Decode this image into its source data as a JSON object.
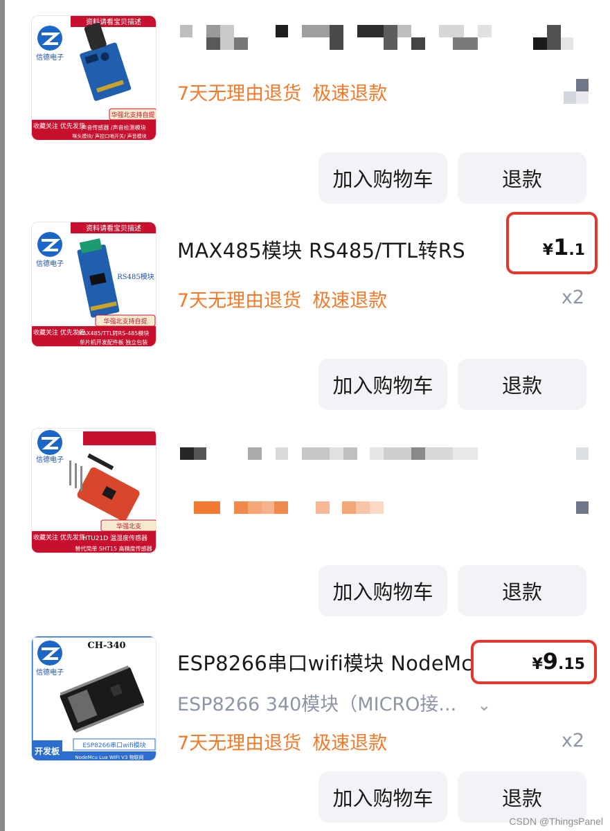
{
  "items": [
    {
      "thumb_top": "资料请看宝贝描述",
      "thumb_brand": "信德电子",
      "thumb_banner": "华强北支持自提",
      "thumb_bottom1": "声音传感器 /声音检测模块",
      "thumb_bottom2": "咪头模块/ 声控口哨开关/ 声音模块",
      "thumb_side": "收藏关注 优先发货",
      "title": "",
      "tags": [
        "7天无理由退货",
        "极速退款"
      ],
      "price": null,
      "qty": "",
      "buttons": {
        "cart": "加入购物车",
        "refund": "退款"
      }
    },
    {
      "thumb_top": "资料请看宝贝描述",
      "thumb_brand": "信德电子",
      "thumb_banner": "华强北支持自提",
      "thumb_label": "RS485模块",
      "thumb_bottom1": "MAX485/TTL转RS-485模块",
      "thumb_bottom2": "单片机开发配件板  独立包装",
      "thumb_side": "收藏关注 优先发货",
      "title": "MAX485模块 RS485/TTL转RS",
      "tags": [
        "7天无理由退货",
        "极速退款"
      ],
      "price": {
        "currency": "¥",
        "int": "1",
        "dec": ".1"
      },
      "qty": "x2",
      "buttons": {
        "cart": "加入购物车",
        "refund": "退款"
      }
    },
    {
      "thumb_brand": "信德电子",
      "thumb_banner": "华强北支",
      "thumb_bottom1": "HTU21D 温湿度传感器",
      "thumb_bottom2": "替代简单 SHT15 高精度传感器",
      "thumb_side": "收藏关注 优先发货",
      "title": "",
      "tags": [],
      "price": null,
      "qty": "",
      "buttons": {
        "cart": "加入购物车",
        "refund": "退款"
      }
    },
    {
      "thumb_top": "CH-340",
      "thumb_brand": "信德电子",
      "thumb_banner": "ESP8266串口wifi模块",
      "thumb_bottom2": "NodeMcu Lua WIFI V3 物联网",
      "thumb_side": "开发板",
      "title": "ESP8266串口wifi模块 NodeMc",
      "sku": "ESP8266 340模块（MICRO接...",
      "tags": [
        "7天无理由退货",
        "极速退款"
      ],
      "price": {
        "currency": "¥",
        "int": "9",
        "dec": ".15"
      },
      "qty": "x2",
      "buttons": {
        "cart": "加入购物车",
        "refund": "退款"
      }
    }
  ],
  "watermark": "CSDN @ThingsPanel",
  "colors": {
    "accent_orange": "#f07a2a",
    "highlight_red": "#e3362c",
    "button_bg": "#f2f3f6",
    "muted": "#8d96a6"
  },
  "icons": [
    "chevron-down-icon",
    "brand-logo-icon"
  ]
}
